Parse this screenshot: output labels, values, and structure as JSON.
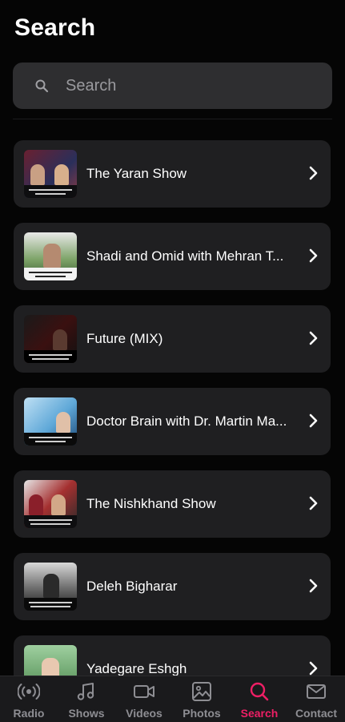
{
  "header": {
    "title": "Search"
  },
  "search": {
    "placeholder": "Search"
  },
  "colors": {
    "accent": "#ee1f65",
    "card": "#1f1f21",
    "background": "#050505"
  },
  "results": [
    {
      "title": "The Yaran Show",
      "thumb_icon": "show-cover-image"
    },
    {
      "title": "Shadi and Omid with Mehran T...",
      "thumb_icon": "show-cover-image"
    },
    {
      "title": "Future (MIX)",
      "thumb_icon": "show-cover-image"
    },
    {
      "title": "Doctor Brain with Dr. Martin Ma...",
      "thumb_icon": "show-cover-image"
    },
    {
      "title": "The Nishkhand Show",
      "thumb_icon": "show-cover-image"
    },
    {
      "title": "Deleh Bigharar",
      "thumb_icon": "show-cover-image"
    },
    {
      "title": "Yadegare Eshgh",
      "thumb_icon": "show-cover-image"
    }
  ],
  "tabs": [
    {
      "label": "Radio",
      "icon": "radio-icon"
    },
    {
      "label": "Shows",
      "icon": "music-note-icon"
    },
    {
      "label": "Videos",
      "icon": "video-camera-icon"
    },
    {
      "label": "Photos",
      "icon": "image-icon"
    },
    {
      "label": "Search",
      "icon": "search-icon",
      "active": true
    },
    {
      "label": "Contact",
      "icon": "envelope-icon"
    }
  ]
}
